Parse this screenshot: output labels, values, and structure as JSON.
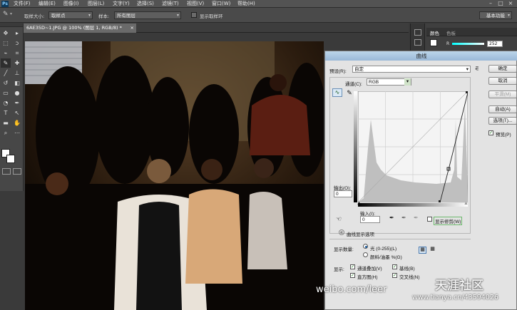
{
  "app": {
    "logo": "Ps"
  },
  "menus": [
    "文件(F)",
    "编辑(E)",
    "图像(I)",
    "图层(L)",
    "文字(Y)",
    "选择(S)",
    "滤镜(T)",
    "视图(V)",
    "窗口(W)",
    "帮助(H)"
  ],
  "window_controls": [
    "–",
    "□",
    "×"
  ],
  "options_bar": {
    "sample_size_label": "取样大小:",
    "sample_size_value": "取样点",
    "sample_label": "样本:",
    "sample_value": "所有图层",
    "show_ring_label": "显示取样环",
    "workspace": "基本功能"
  },
  "document_tab": {
    "title": "6AE35D~1.JPG @ 100% (图层 1, RGB/8) *",
    "close": "×"
  },
  "right_panel": {
    "tabs": [
      "颜色",
      "色板"
    ],
    "r_label": "R",
    "r_value": "252"
  },
  "curves_dialog": {
    "title": "曲线",
    "preset_label": "预设(R):",
    "preset_value": "自定",
    "channel_label": "通道(C):",
    "channel_value": "RGB",
    "output_label": "输出(O):",
    "output_value": "0",
    "input_label": "输入(I):",
    "input_value": "0",
    "show_clipping_label": "显示修剪(W)",
    "curve_display_options": "曲线显示选项",
    "show_amount_label": "显示数量:",
    "light_option": "光 (0-255)(L)",
    "pigment_option": "颜料/油墨 %(G)",
    "show_label": "显示:",
    "check_channel_overlays": "通道叠加(V)",
    "check_baseline": "基线(B)",
    "check_histogram": "直方图(H)",
    "check_intersection": "交叉线(N)",
    "buttons": {
      "ok": "确定",
      "cancel": "取消",
      "smooth": "平滑(M)",
      "auto": "自动(A)",
      "options": "选项(T)...",
      "preview": "预览(P)"
    }
  },
  "overlays": {
    "weibo": "weibo.com/leer",
    "tianya_logo": "天涯社区",
    "tianya_url": "www.tianya.cn/43594026"
  }
}
